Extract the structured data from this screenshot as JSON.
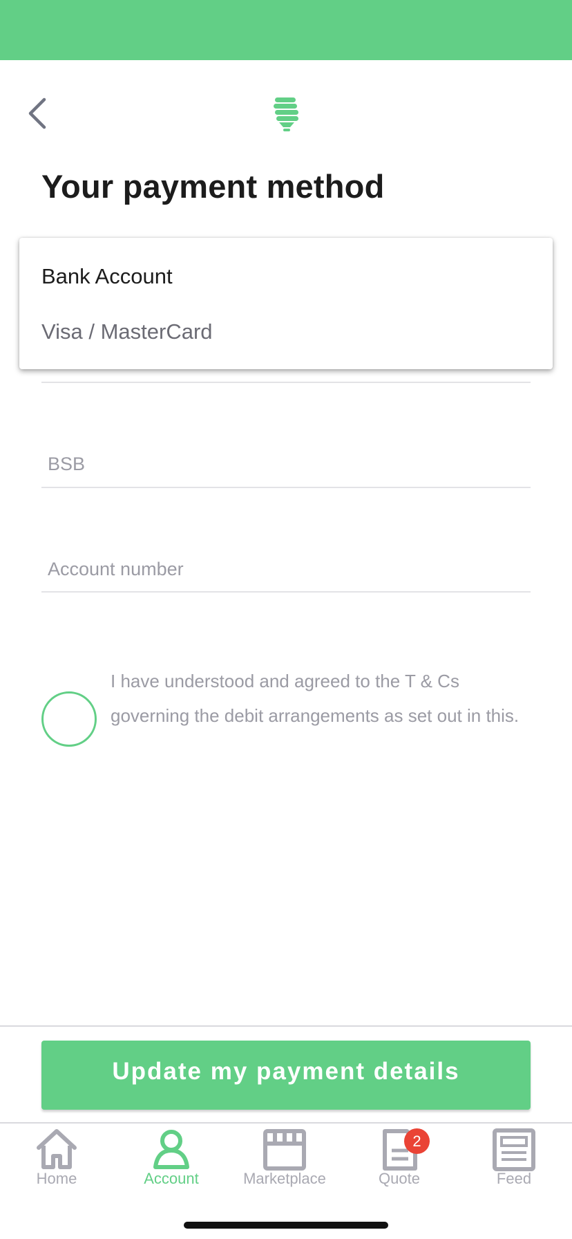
{
  "header": {
    "title": "Your payment method"
  },
  "payment_method": {
    "options": [
      "Bank Account",
      "Visa / MasterCard"
    ],
    "selected": "Bank Account"
  },
  "form": {
    "bsb_placeholder": "BSB",
    "account_number_placeholder": "Account number",
    "agreement_text": "I have understood and agreed to the T & Cs governing the debit arrangements as set out in this.",
    "agreement_checked": false
  },
  "submit_label": "Update my payment details",
  "tabbar": {
    "items": [
      {
        "label": "Home",
        "icon": "home-icon",
        "active": false
      },
      {
        "label": "Account",
        "icon": "account-icon",
        "active": true
      },
      {
        "label": "Marketplace",
        "icon": "marketplace-icon",
        "active": false
      },
      {
        "label": "Quote",
        "icon": "quote-icon",
        "active": false,
        "badge": "2"
      },
      {
        "label": "Feed",
        "icon": "feed-icon",
        "active": false
      }
    ]
  },
  "colors": {
    "brand_green": "#62cf86",
    "badge_red": "#ea4335",
    "muted_text": "#9b9ba4"
  }
}
